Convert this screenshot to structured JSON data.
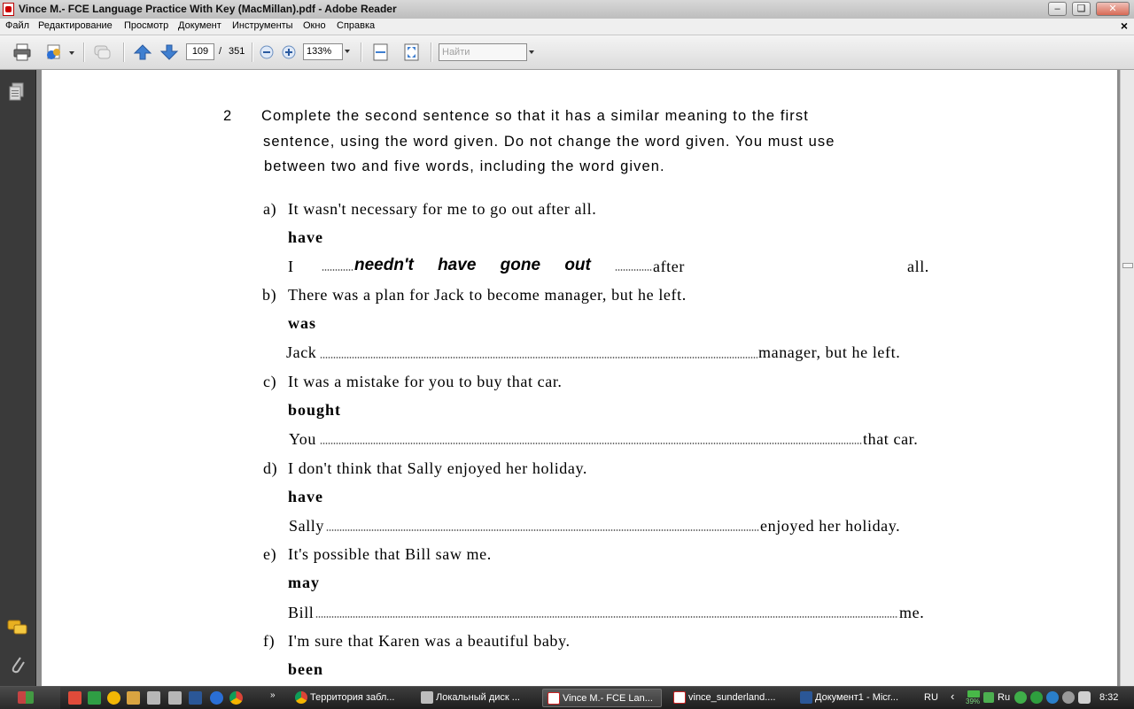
{
  "window": {
    "title": "Vince M.- FCE Language Practice With Key (MacMillan).pdf - Adobe Reader"
  },
  "menu": [
    "Файл",
    "Редактирование",
    "Просмотр",
    "Документ",
    "Инструменты",
    "Окно",
    "Справка"
  ],
  "toolbar": {
    "page_current": "109",
    "page_separator": "/",
    "page_total": "351",
    "zoom": "133%",
    "search_placeholder": "Найти"
  },
  "document": {
    "exercise_number": "2",
    "instructions": [
      "Complete the second sentence so that it has a similar meaning to the first",
      "sentence, using the word given. Do not change the word given. You must use",
      "between two and five words, including the word given."
    ],
    "items": [
      {
        "letter": "a)",
        "sentence": "It wasn't necessary for me to go out after all.",
        "keyword": "have",
        "start": "I",
        "answer": "needn't have gone out",
        "after_answer": "after",
        "end": "all."
      },
      {
        "letter": "b)",
        "sentence": "There was a plan for Jack to become manager, but he left.",
        "keyword": "was",
        "start": "Jack",
        "end": "manager, but he left."
      },
      {
        "letter": "c)",
        "sentence": "It was a mistake for you to buy that car.",
        "keyword": "bought",
        "start": "You",
        "end": "that car."
      },
      {
        "letter": "d)",
        "sentence": "I don't think that Sally enjoyed her holiday.",
        "keyword": "have",
        "start": "Sally",
        "end": "enjoyed her holiday."
      },
      {
        "letter": "e)",
        "sentence": "It's possible that Bill saw me.",
        "keyword": "may",
        "start": "Bill",
        "end": "me."
      },
      {
        "letter": "f)",
        "sentence": "I'm sure that Karen was a beautiful baby.",
        "keyword": "been"
      }
    ]
  },
  "taskbar": {
    "tasks": [
      {
        "label": "Территория забл...",
        "icon_color": "#e0a020"
      },
      {
        "label": "Локальный диск ...",
        "icon_color": "#c0c0c0"
      },
      {
        "label": "Vince M.- FCE Lan...",
        "icon_color": "#cc2222"
      },
      {
        "label": "vince_sunderland....",
        "icon_color": "#cc2222"
      },
      {
        "label": "Документ1 - Micr...",
        "icon_color": "#2b5797"
      }
    ],
    "language": "RU",
    "battery": "39%",
    "tray_lang2": "Ru",
    "clock": "8:32"
  }
}
